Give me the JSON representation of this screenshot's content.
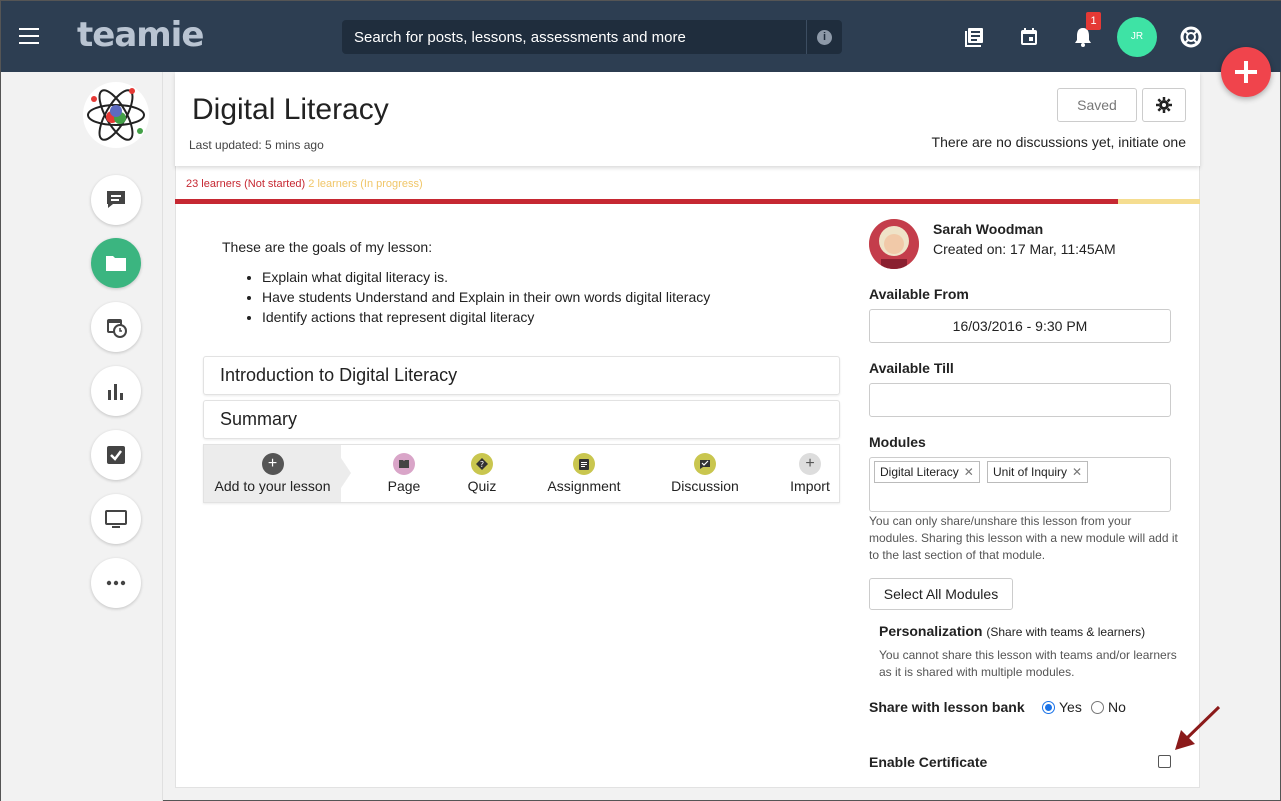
{
  "topbar": {
    "logo": "teamie",
    "search_placeholder": "Search for posts, lessons, assessments and more",
    "notification_count": "1",
    "user_initials": "JR"
  },
  "header": {
    "title": "Digital Literacy",
    "last_updated": "Last updated: 5 mins ago",
    "saved_label": "Saved",
    "discussion_note": "There are no discussions yet, initiate one"
  },
  "progress": {
    "not_started": "23 learners (Not started)",
    "in_progress": "2 learners (In progress)",
    "fraction_not_started": 0.92
  },
  "content": {
    "goals_intro": "These are the goals of my lesson:",
    "goals": [
      "Explain what digital literacy is.",
      "Have students Understand and Explain in their own words digital literacy",
      "Identify actions that represent digital literacy"
    ],
    "sections": [
      "Introduction to Digital Literacy",
      "Summary"
    ]
  },
  "add_bar": {
    "main_label": "Add to your lesson",
    "items": [
      {
        "label": "Page",
        "color": "#d9a5c8"
      },
      {
        "label": "Quiz",
        "color": "#c9c64f"
      },
      {
        "label": "Assignment",
        "color": "#c9c64f"
      },
      {
        "label": "Discussion",
        "color": "#c9c64f"
      },
      {
        "label": "Import",
        "color": "#dddddd"
      }
    ]
  },
  "author": {
    "name": "Sarah Woodman",
    "created": "Created on: 17 Mar, 11:45AM"
  },
  "settings": {
    "available_from_label": "Available From",
    "available_from_value": "16/03/2016 - 9:30 PM",
    "available_till_label": "Available Till",
    "available_till_value": "",
    "modules_label": "Modules",
    "modules": [
      "Digital Literacy",
      "Unit of Inquiry"
    ],
    "modules_help": "You can only share/unshare this lesson from your modules. Sharing this lesson with a new module will add it to the last section of that module.",
    "select_all_label": "Select All Modules",
    "personalization_title": "Personalization",
    "personalization_sub": "(Share with teams & learners)",
    "personalization_note": "You cannot share this lesson with teams and/or learners as it is shared with multiple modules.",
    "share_label": "Share with lesson bank",
    "share_yes": "Yes",
    "share_no": "No",
    "enable_certificate_label": "Enable Certificate"
  },
  "colors": {
    "topbar": "#2d3e52",
    "accent_green": "#3bb580",
    "fab_red": "#f0444c",
    "progress_red": "#c62832",
    "progress_yellow": "#f0c668"
  }
}
